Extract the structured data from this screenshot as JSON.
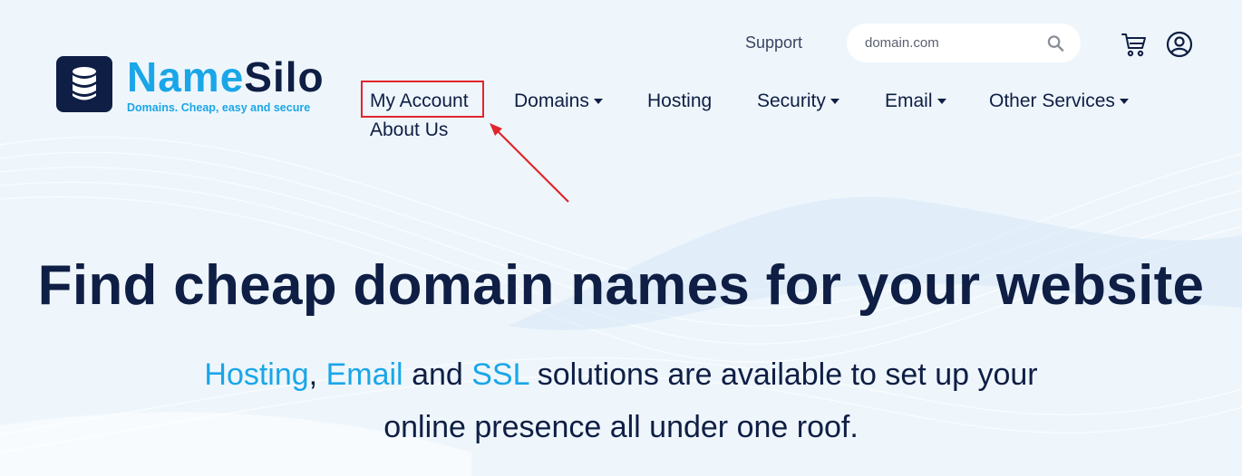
{
  "brand": {
    "name_part1": "Name",
    "name_part2": "Silo",
    "tagline": "Domains. Cheap, easy and secure"
  },
  "top": {
    "support": "Support",
    "search_placeholder": "domain.com",
    "cart_icon": "cart-icon",
    "user_icon": "user-icon"
  },
  "nav": {
    "items": [
      {
        "label": "My Account",
        "dropdown": false
      },
      {
        "label": "Domains",
        "dropdown": true
      },
      {
        "label": "Hosting",
        "dropdown": false
      },
      {
        "label": "Security",
        "dropdown": true
      },
      {
        "label": "Email",
        "dropdown": true
      },
      {
        "label": "Other Services",
        "dropdown": true
      }
    ],
    "about": "About Us"
  },
  "annotation": {
    "highlight_color": "#e0262b"
  },
  "hero": {
    "title": "Find cheap domain names for your website",
    "sub": {
      "hosting": "Hosting",
      "comma": ",",
      "email": "Email",
      "and": "and",
      "ssl": "SSL",
      "rest1": "solutions are available to set up your",
      "rest2": "online presence all under one roof."
    }
  },
  "colors": {
    "navy": "#0f1e44",
    "accent": "#1aa6e8",
    "background": "#eef6fc"
  }
}
